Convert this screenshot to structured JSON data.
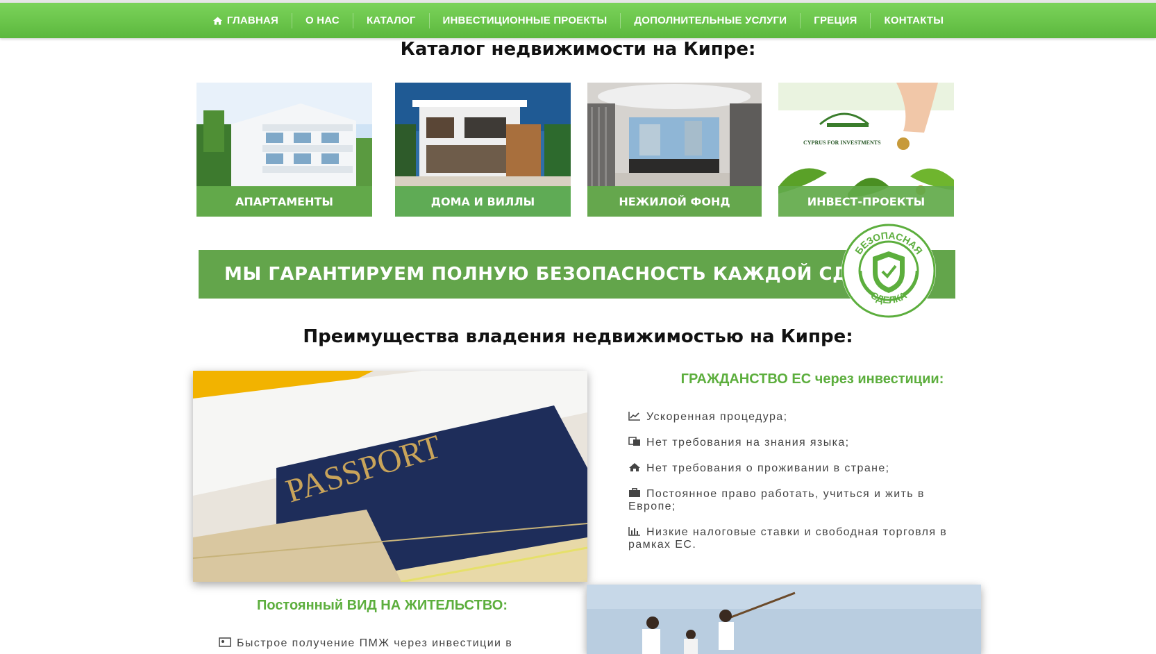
{
  "nav": {
    "items": [
      {
        "label": "ГЛАВНАЯ",
        "icon": "home-icon"
      },
      {
        "label": "О НАС"
      },
      {
        "label": "КАТАЛОГ"
      },
      {
        "label": "ИНВЕСТИЦИОННЫЕ ПРОЕКТЫ"
      },
      {
        "label": "ДОПОЛНИТЕЛЬНЫЕ УСЛУГИ"
      },
      {
        "label": "ГРЕЦИЯ"
      },
      {
        "label": "КОНТАКТЫ"
      }
    ]
  },
  "catalog": {
    "title": "Каталог недвижимости на Кипре:",
    "cards": [
      {
        "label": "АПАРТАМЕНТЫ"
      },
      {
        "label": "ДОМА И ВИЛЛЫ"
      },
      {
        "label": "НЕЖИЛОЙ ФОНД"
      },
      {
        "label": "ИНВЕСТ-ПРОЕКТЫ",
        "logo_text": "CYPRUS FOR INVESTMENTS"
      }
    ]
  },
  "banner": {
    "text": "МЫ ГАРАНТИРУЕМ ПОЛНУЮ БЕЗОПАСНОСТЬ КАЖДОЙ СДЕЛКИ",
    "seal_top": "БЕЗОПАСНАЯ",
    "seal_bottom": "СДЕЛКА"
  },
  "advantages": {
    "title": "Преимущества владения недвижимостью на Кипре:",
    "citizenship": {
      "title": "ГРАЖДАНСТВО ЕС через инвестиции:",
      "items": [
        {
          "icon": "chart-line-icon",
          "text": "Ускоренная процедура;"
        },
        {
          "icon": "language-icon",
          "text": "Нет требования на знания языка;"
        },
        {
          "icon": "home-icon",
          "text": "Нет требования о проживании в стране;"
        },
        {
          "icon": "briefcase-icon",
          "text": "Постоянное право работать, учиться и жить в Европе;"
        },
        {
          "icon": "bar-chart-icon",
          "text": "Низкие налоговые ставки и свободная торговля в рамках ЕС."
        }
      ]
    },
    "residence": {
      "title": "Постоянный ВИД НА ЖИТЕЛЬСТВО:",
      "first_item": "Быстрое получение ПМЖ через инвестиции в"
    },
    "passport_text": "PASSPORT"
  },
  "colors": {
    "nav": "#5cb83e",
    "accent": "#63a54b",
    "subheading": "#5cae3d"
  }
}
